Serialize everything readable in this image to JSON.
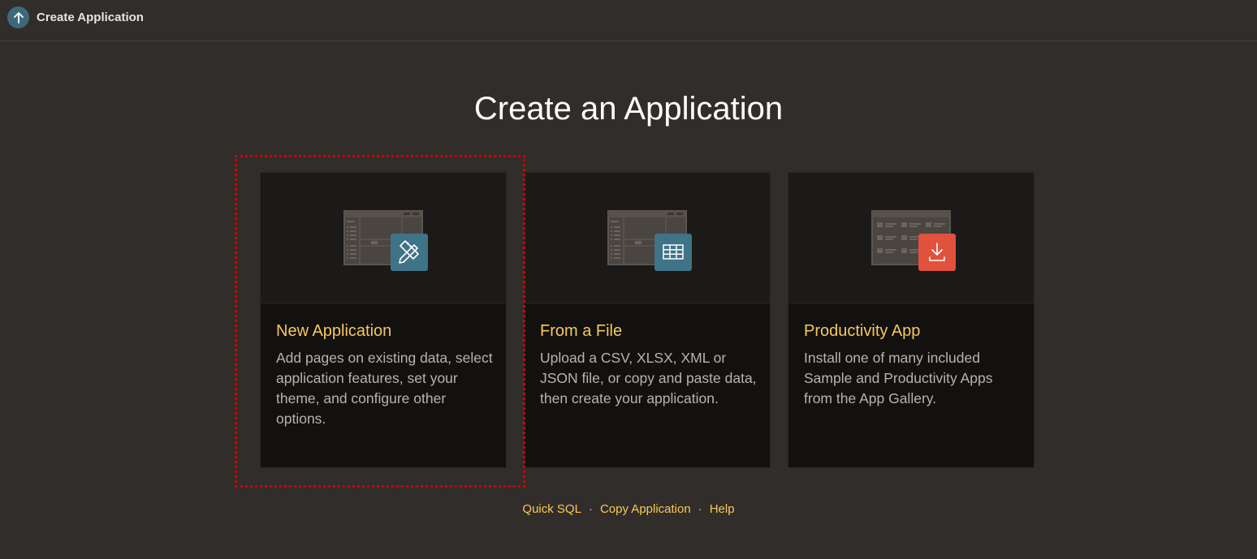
{
  "header": {
    "title": "Create Application",
    "back_icon": "arrow-up-icon",
    "accent": "#3d6a7b"
  },
  "main": {
    "heading": "Create an Application",
    "cards": [
      {
        "title": "New Application",
        "description": "Add pages on existing data, select application features, set your theme, and configure other options.",
        "icon": "pencil-ruler-icon",
        "badge_color": "#3f7387"
      },
      {
        "title": "From a File",
        "description": "Upload a CSV, XLSX, XML or JSON file, or copy and paste data, then create your application.",
        "icon": "table-grid-icon",
        "badge_color": "#3f7387"
      },
      {
        "title": "Productivity App",
        "description": "Install one of many included Sample and Productivity Apps from the App Gallery.",
        "icon": "download-icon",
        "badge_color": "#e0523c"
      }
    ]
  },
  "footer": {
    "links": [
      "Quick SQL",
      "Copy Application",
      "Help"
    ],
    "separator": "·"
  },
  "colors": {
    "background": "#312d2a",
    "card": "#121110",
    "title_accent": "#f8c85b",
    "focus_outline": "#d10000"
  }
}
